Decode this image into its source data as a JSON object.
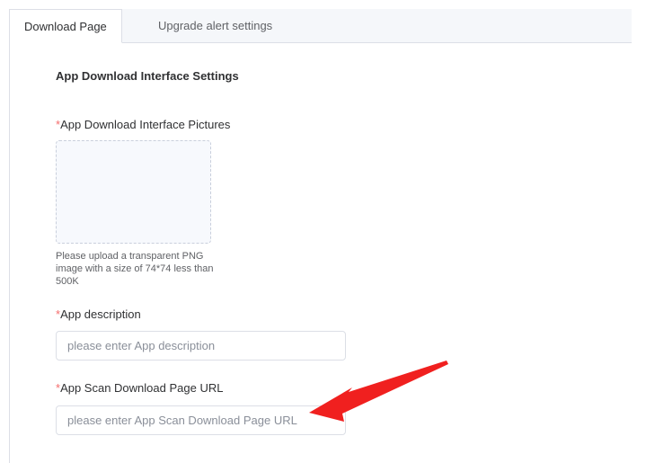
{
  "tabs": [
    {
      "label": "Download Page",
      "active": true
    },
    {
      "label": "Upgrade alert settings",
      "active": false
    }
  ],
  "section_title": "App Download Interface Settings",
  "fields": {
    "pictures": {
      "required_mark": "*",
      "label": "App Download Interface Pictures",
      "hint": "Please upload a transparent PNG image with a size of 74*74 less than 500K"
    },
    "description": {
      "required_mark": "*",
      "label": "App description",
      "placeholder": "please enter App description",
      "value": ""
    },
    "scan_url": {
      "required_mark": "*",
      "label": "App Scan Download Page URL",
      "placeholder": "please enter App Scan Download Page URL",
      "value": ""
    }
  },
  "colors": {
    "required": "#f56c6c",
    "annotation_arrow": "#f0201f"
  }
}
